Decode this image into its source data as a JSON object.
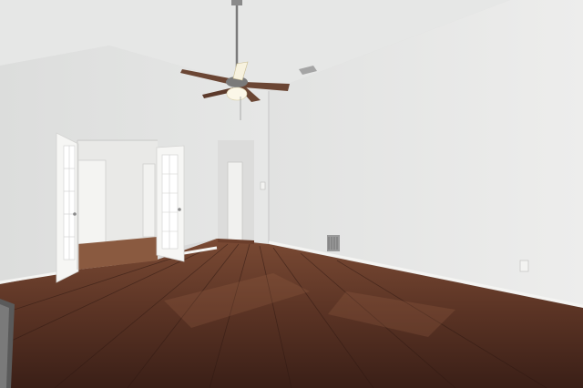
{
  "photo": {
    "subject": "empty-room-interior",
    "colors": {
      "ceiling": "#e6e7e6",
      "wall_left": "#e3e4e3",
      "wall_right": "#e8e9e8",
      "floor_dark": "#3a1f17",
      "floor_mid": "#5a3324",
      "floor_light": "#7a4a34",
      "trim": "#f4f4f2",
      "fan_blade": "#6b4634",
      "fan_light": "#f7f2df",
      "door_glass": "#f5f5f3",
      "vent": "#9a9a9a"
    }
  }
}
